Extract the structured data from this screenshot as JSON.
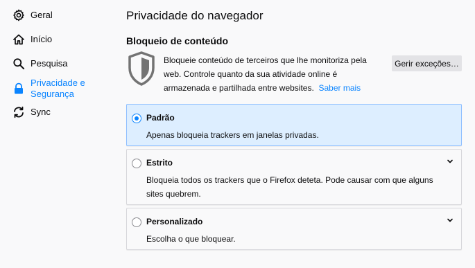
{
  "sidebar": {
    "items": [
      {
        "label": "Geral",
        "icon": "gear-icon"
      },
      {
        "label": "Início",
        "icon": "home-icon"
      },
      {
        "label": "Pesquisa",
        "icon": "search-icon"
      },
      {
        "label": "Privacidade e Segurança",
        "icon": "lock-icon",
        "active": true
      },
      {
        "label": "Sync",
        "icon": "sync-icon"
      }
    ]
  },
  "main": {
    "title": "Privacidade do navegador",
    "section_title": "Bloqueio de conteúdo",
    "description": "Bloqueie conteúdo de terceiros que lhe monitoriza pela web. Controle quanto da sua atividade online é armazenada e partilhada entre websites.",
    "learn_more": "Saber mais",
    "exceptions_button": "Gerir exceções…",
    "options": [
      {
        "title": "Padrão",
        "description": "Apenas bloqueia trackers em janelas privadas.",
        "selected": true
      },
      {
        "title": "Estrito",
        "description": "Bloqueia todos os trackers que o Firefox deteta. Pode causar com que alguns sites quebrem.",
        "selected": false
      },
      {
        "title": "Personalizado",
        "description": "Escolha o que bloquear.",
        "selected": false
      }
    ]
  },
  "colors": {
    "accent": "#0a84ff",
    "selected_bg": "#ddeeff",
    "background": "#f9f9fa"
  }
}
